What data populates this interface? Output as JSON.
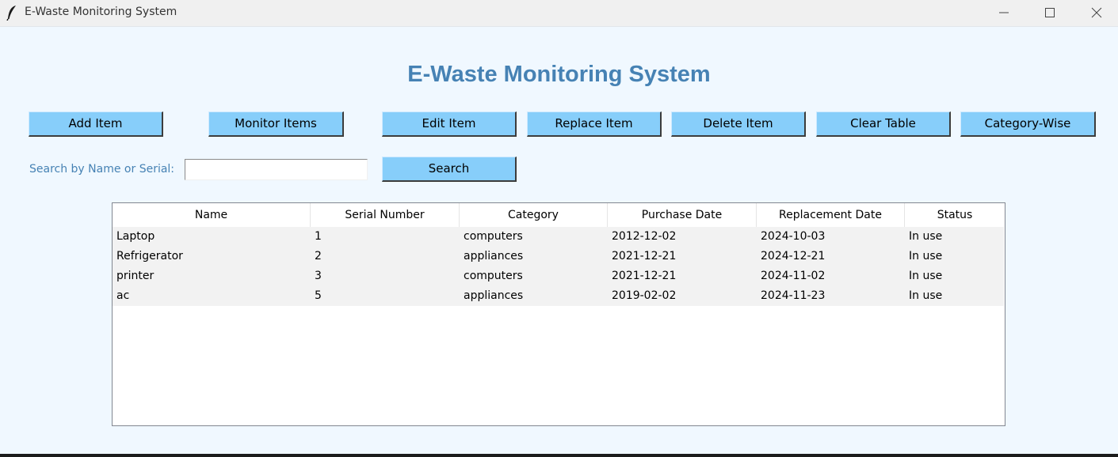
{
  "window": {
    "title": "E-Waste Monitoring System",
    "controls": [
      "minimize-icon",
      "maximize-icon",
      "close-icon"
    ]
  },
  "heading": "E-Waste Monitoring System",
  "toolbar": {
    "add": "Add Item",
    "monitor": "Monitor Items",
    "edit": "Edit Item",
    "replace": "Replace Item",
    "delete": "Delete Item",
    "clear": "Clear Table",
    "category": "Category-Wise"
  },
  "search": {
    "label": "Search by Name or Serial:",
    "value": "",
    "button": "Search"
  },
  "table": {
    "columns": [
      "Name",
      "Serial Number",
      "Category",
      "Purchase Date",
      "Replacement Date",
      "Status"
    ],
    "rows": [
      [
        "Laptop",
        "1",
        "computers",
        "2012-12-02",
        "2024-10-03",
        "In use"
      ],
      [
        "Refrigerator",
        "2",
        "appliances",
        "2021-12-21",
        "2024-12-21",
        "In use"
      ],
      [
        "printer",
        "3",
        "computers",
        "2021-12-21",
        "2024-11-02",
        "In use"
      ],
      [
        "ac",
        "5",
        "appliances",
        "2019-02-02",
        "2024-11-23",
        "In use"
      ]
    ]
  },
  "colors": {
    "background": "#f0f8ff",
    "button": "#87cefa",
    "heading": "#4682b4",
    "label": "#4682b4",
    "row": "#f2f2f2"
  }
}
